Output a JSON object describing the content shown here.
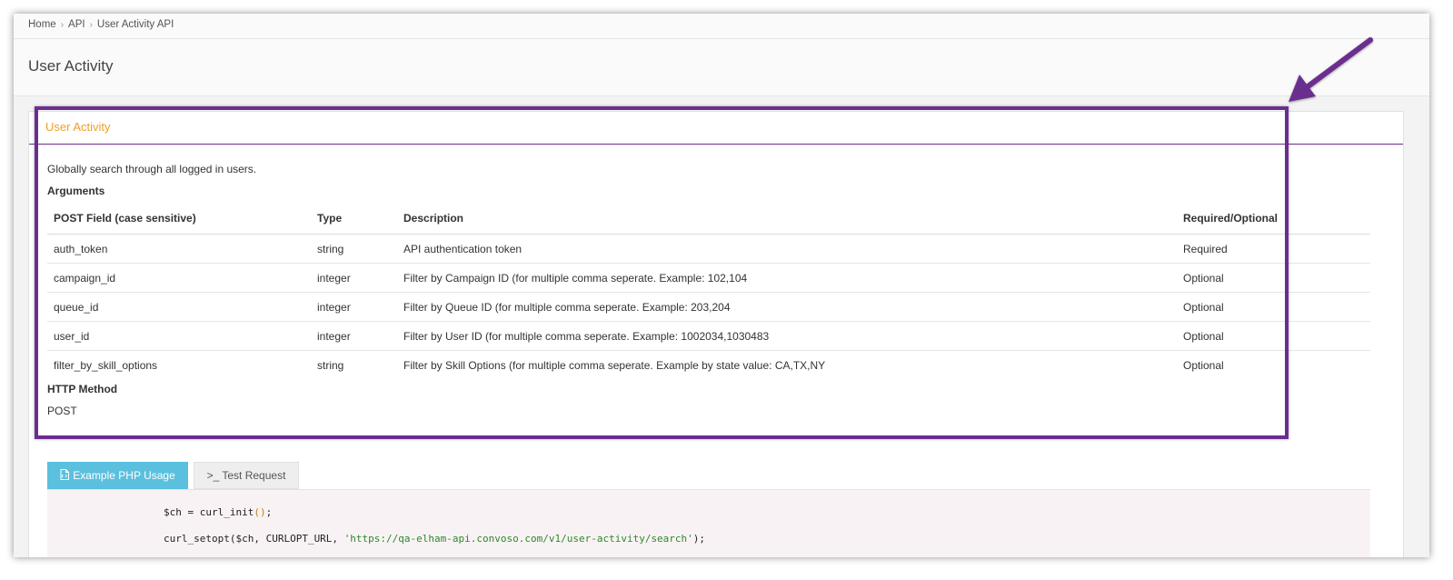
{
  "breadcrumb": {
    "items": [
      "Home",
      "API",
      "User Activity API"
    ],
    "separator": "›"
  },
  "page": {
    "title": "User Activity"
  },
  "panel": {
    "title": "User Activity",
    "intro": "Globally search through all logged in users.",
    "arguments_heading": "Arguments",
    "table": {
      "headers": [
        "POST Field (case sensitive)",
        "Type",
        "Description",
        "Required/Optional"
      ],
      "rows": [
        [
          "auth_token",
          "string",
          "API authentication token",
          "Required"
        ],
        [
          "campaign_id",
          "integer",
          "Filter by Campaign ID (for multiple comma seperate. Example: 102,104",
          "Optional"
        ],
        [
          "queue_id",
          "integer",
          "Filter by Queue ID (for multiple comma seperate. Example: 203,204",
          "Optional"
        ],
        [
          "user_id",
          "integer",
          "Filter by User ID (for multiple comma seperate. Example: 1002034,1030483",
          "Optional"
        ],
        [
          "filter_by_skill_options",
          "string",
          "Filter by Skill Options (for multiple comma seperate. Example by state value: CA,TX,NY",
          "Optional"
        ]
      ]
    },
    "method_heading": "HTTP Method",
    "method_value": "POST"
  },
  "tabs": {
    "example_label": "Example PHP Usage",
    "example_icon": "file-code-icon",
    "test_label": ">_ Test Request"
  },
  "code": {
    "line1_var": "$ch = curl_init",
    "line1_parens": "()",
    "line1_end": ";",
    "line2_start": "curl_setopt($ch, CURLOPT_URL, ",
    "line2_str": "'https://qa-elham-api.convoso.com/v1/user-activity/search'",
    "line2_end": ");"
  },
  "colors": {
    "panel_title": "#f0a028",
    "highlight": "#6b2d8f",
    "active_tab": "#5bc0de",
    "required": "#e0201c"
  }
}
